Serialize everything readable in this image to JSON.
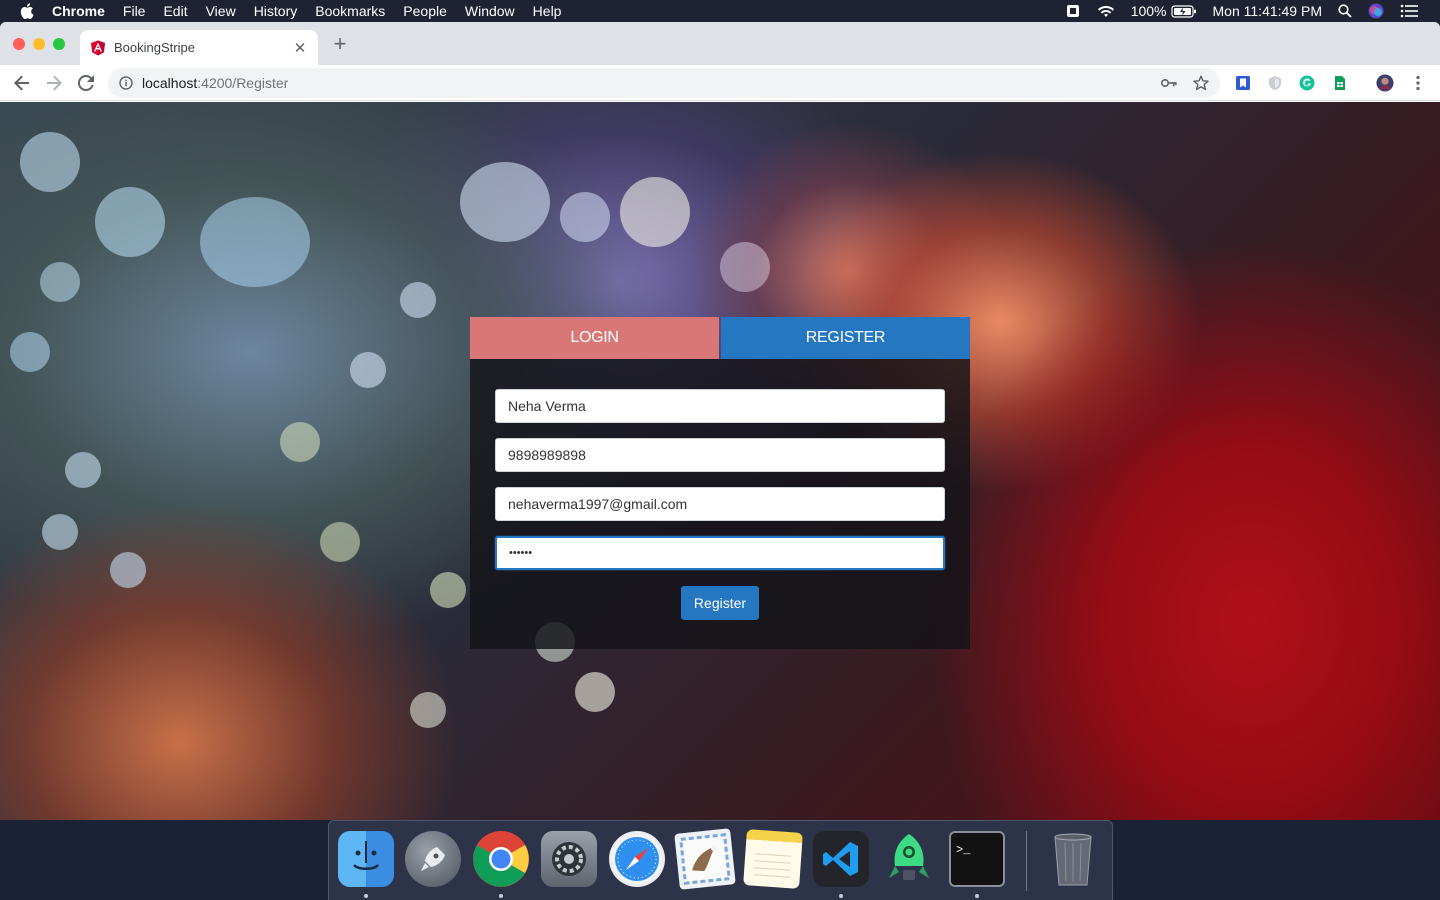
{
  "menubar": {
    "app": "Chrome",
    "items": [
      "File",
      "Edit",
      "View",
      "History",
      "Bookmarks",
      "People",
      "Window",
      "Help"
    ],
    "battery": "100%",
    "clock": "Mon 11:41:49 PM"
  },
  "browser": {
    "tab_title": "BookingStripe",
    "url_host": "localhost",
    "url_rest": ":4200/Register"
  },
  "auth": {
    "login_tab": "LOGIN",
    "register_tab": "REGISTER",
    "name_value": "Neha Verma",
    "phone_value": "9898989898",
    "email_value": "nehaverma1997@gmail.com",
    "password_value": "••••••",
    "register_button": "Register"
  },
  "colors": {
    "login_tab": "#d97777",
    "register_tab": "#2577c2",
    "button": "#2577c2"
  },
  "dock": {
    "apps": [
      "finder-icon",
      "launchpad-icon",
      "chrome-icon",
      "system-preferences-icon",
      "safari-icon",
      "mail-icon",
      "notes-icon",
      "vscode-icon",
      "android-studio-icon",
      "terminal-icon",
      "trash-icon"
    ]
  }
}
